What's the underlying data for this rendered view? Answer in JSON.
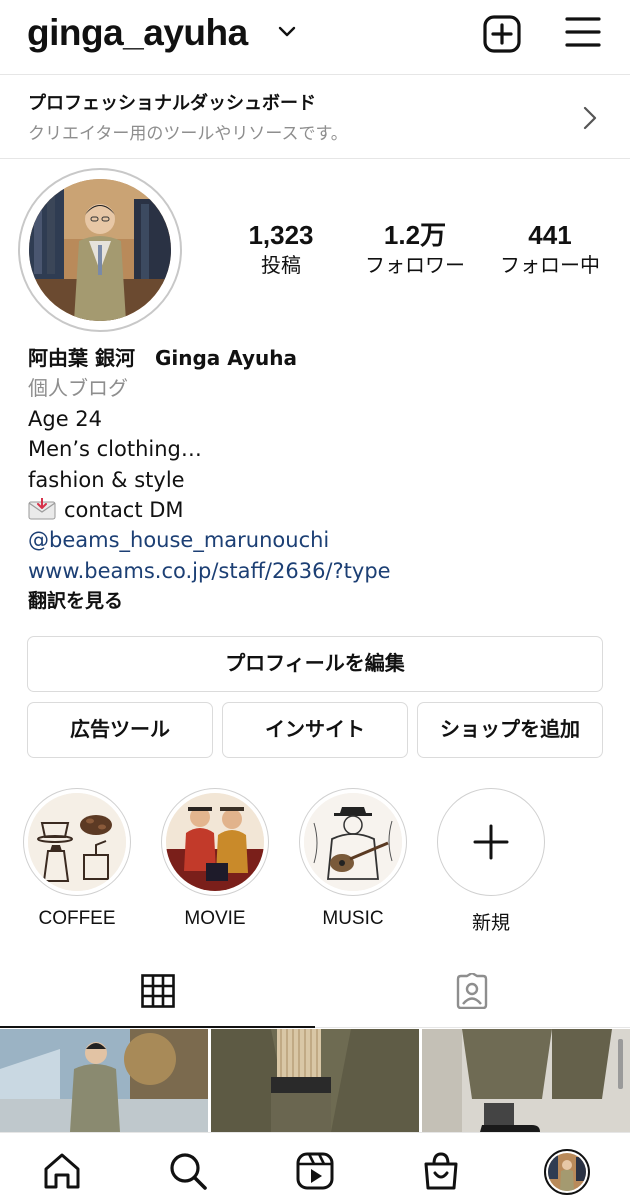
{
  "header": {
    "username": "ginga_ayuha"
  },
  "professional": {
    "title": "プロフェッショナルダッシュボード",
    "subtitle": "クリエイター用のツールやリソースです。"
  },
  "stats": {
    "posts_count": "1,323",
    "posts_label": "投稿",
    "followers_count": "1.2万",
    "followers_label": "フォロワー",
    "following_count": "441",
    "following_label": "フォロー中"
  },
  "bio": {
    "name": "阿由葉 銀河　Ginga Ayuha",
    "category": "個人ブログ",
    "line1": "Age 24",
    "line2": "Men’s clothing…",
    "line3": "fashion & style",
    "contact": "contact  DM",
    "mention": "@beams_house_marunouchi",
    "url": "www.beams.co.jp/staff/2636/?type",
    "translate": "翻訳を見る"
  },
  "buttons": {
    "edit_profile": "プロフィールを編集",
    "ad_tools": "広告ツール",
    "insights": "インサイト",
    "add_shop": "ショップを追加"
  },
  "highlights": [
    {
      "label": "COFFEE"
    },
    {
      "label": "MOVIE"
    },
    {
      "label": "MUSIC"
    },
    {
      "label": "新規"
    }
  ],
  "colors": {
    "link": "#1c3f74",
    "secondary_text": "#8e8e8e",
    "border": "#dbdbdb"
  },
  "icons": {
    "header": [
      "chevron-down-icon",
      "new-post-icon",
      "menu-icon"
    ],
    "tabs": [
      "grid-icon",
      "tagged-icon"
    ],
    "nav": [
      "home-icon",
      "search-icon",
      "reels-icon",
      "shop-icon",
      "profile-avatar"
    ]
  }
}
